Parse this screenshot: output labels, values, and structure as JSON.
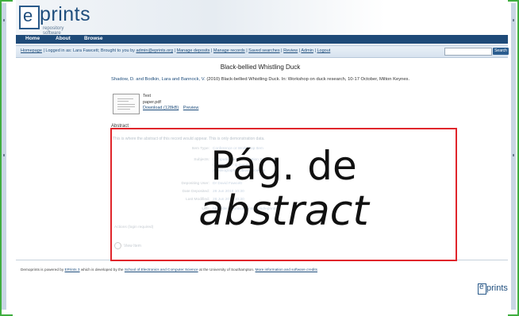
{
  "header": {
    "logo_text": "prints",
    "logo_letter": "e",
    "tagline": "repository software"
  },
  "navbar": {
    "items": [
      "Home",
      "About",
      "Browse"
    ]
  },
  "linkbar": {
    "homepage": "Homepage",
    "login_text": "Logged in as: Lara Fawcett; Brought to you by",
    "email": "admin@eprints.org",
    "links": [
      "Manage deposits",
      "Manage records",
      "Saved searches",
      "Review",
      "Admin",
      "Logout"
    ],
    "search_placeholder": "",
    "search_button": "Search"
  },
  "record": {
    "title": "Black-bellied Whistling Duck",
    "citation_authors": "Shadow, D. and Bodkin, Lara and Bannock, V.",
    "citation_rest": "(2010) Black-bellied Whistling Duck. In: Workshop on duck research, 10-17 October, Milton Keynes.",
    "doc_type": "Text",
    "doc_file": "paper.pdf",
    "download_link": "Download (128kB)",
    "preview_link": "Preview",
    "abstract_heading": "Abstract",
    "abstract_text": "This is where the abstract of this record would appear. This is only demonstration data.",
    "fields": [
      {
        "key": "Item Type:",
        "value": "Conference or Workshop Item"
      },
      {
        "key": "Subjects:",
        "value": "Computing and Information Sciences"
      },
      {
        "key": "",
        "value": "Q Science > Q General"
      },
      {
        "key": "",
        "value": "Z Bibliography. Library Science"
      },
      {
        "key": "Depositing User:",
        "value": "Dr David Fawcett"
      },
      {
        "key": "Date Deposited:",
        "value": "28 Jun 2018 10:30"
      },
      {
        "key": "Last Modified:",
        "value": "28 Jun 2018 10:30"
      },
      {
        "key": "URI:",
        "value": "http://demoprints.eprints.org/id/eprint/45"
      }
    ],
    "actions_heading": "Actions (login required)",
    "view_item": "View Item"
  },
  "footer": {
    "text_1": "Demoprints is powered by",
    "link_1": "EPrints 3",
    "text_2": "which is developed by the",
    "link_2": "School of Electronics and Computer Science",
    "text_3": "at the University of Southampton.",
    "link_3": "More information and software credits",
    "logo_text": "prints",
    "logo_letter": "e"
  },
  "annotation": {
    "line1": "Pág.  de",
    "line2": "abstract",
    "border_color": "#e0252b"
  },
  "colors": {
    "brand": "#1e4a78",
    "frame": "#3fae3f",
    "link": "#1f4e7d"
  }
}
